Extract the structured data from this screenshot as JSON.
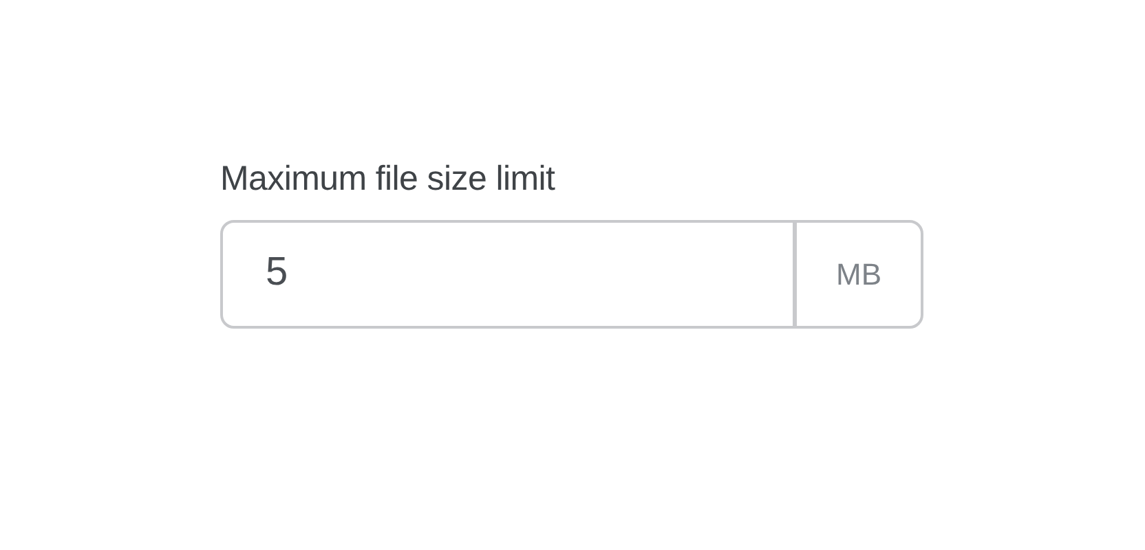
{
  "field": {
    "label": "Maximum file size limit",
    "value": "5",
    "unit": "MB"
  }
}
